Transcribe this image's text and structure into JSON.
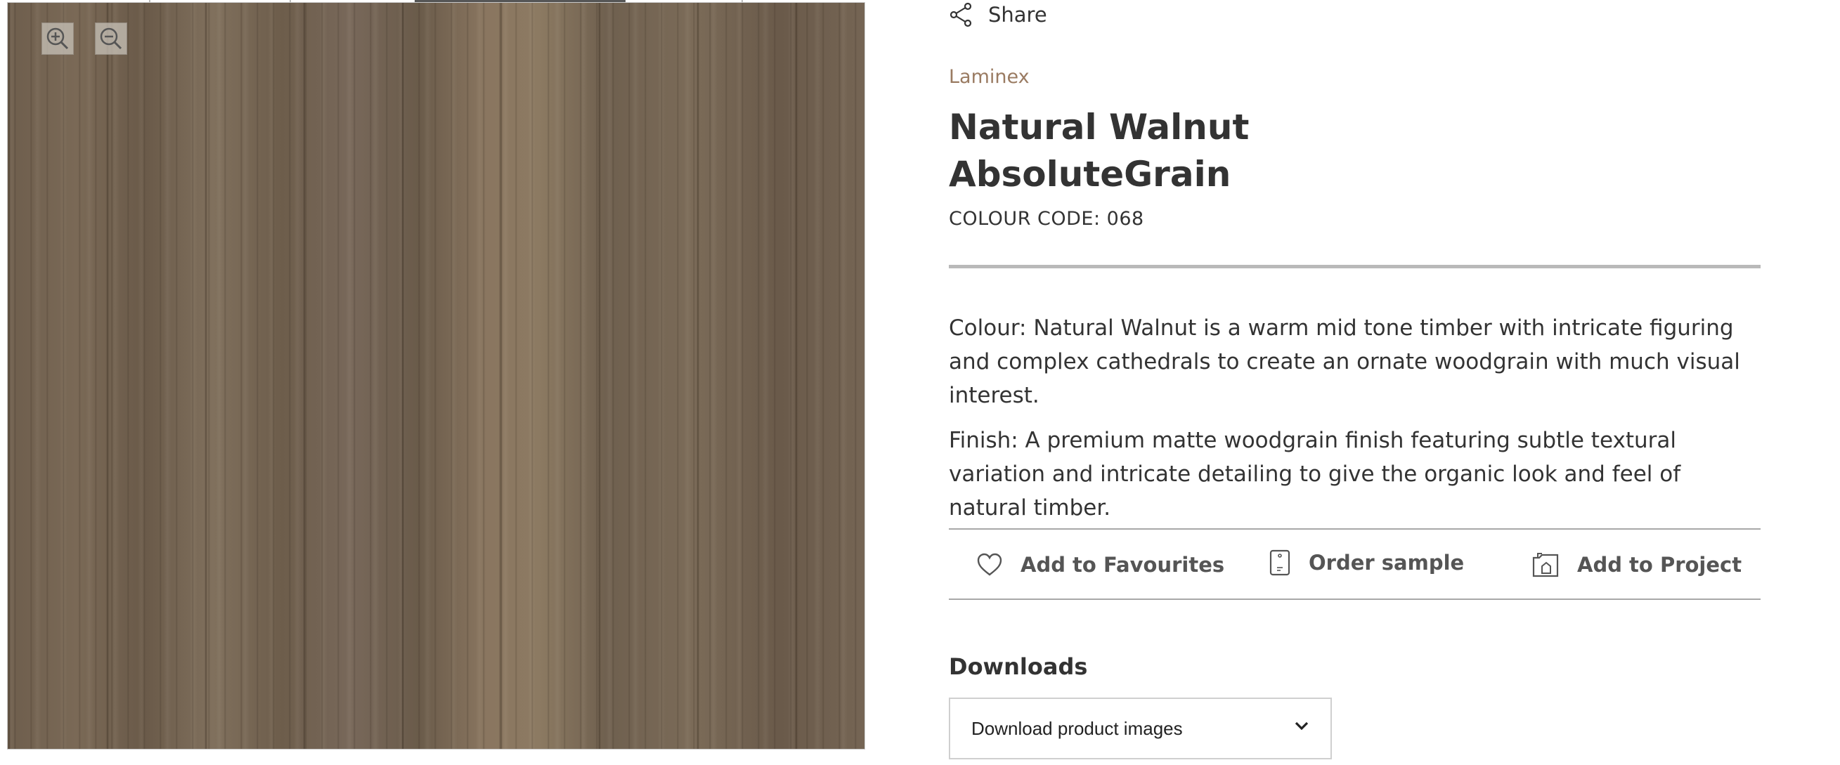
{
  "viewer": {
    "zoom_in_icon": "zoom-in-icon",
    "zoom_out_icon": "zoom-out-icon"
  },
  "share": {
    "label": "Share",
    "icon": "share-icon"
  },
  "product": {
    "brand": "Laminex",
    "title_line1": "Natural Walnut",
    "title_line2": "AbsoluteGrain",
    "colour_code": "COLOUR CODE: 068",
    "description_colour": "Colour: Natural Walnut is a warm mid tone timber with intricate figuring and complex cathedrals to create an ornate woodgrain with much visual interest.",
    "description_finish": "Finish: A premium matte woodgrain finish featuring subtle textural variation and intricate detailing to give the organic look and feel of natural timber."
  },
  "actions": {
    "favourites": "Add to Favourites",
    "sample": "Order sample",
    "project": "Add to Project"
  },
  "downloads": {
    "heading": "Downloads",
    "selected": "Download product images"
  },
  "colors": {
    "brand": "#9a7b62",
    "text": "#333333",
    "rule": "#b9b9b9"
  }
}
